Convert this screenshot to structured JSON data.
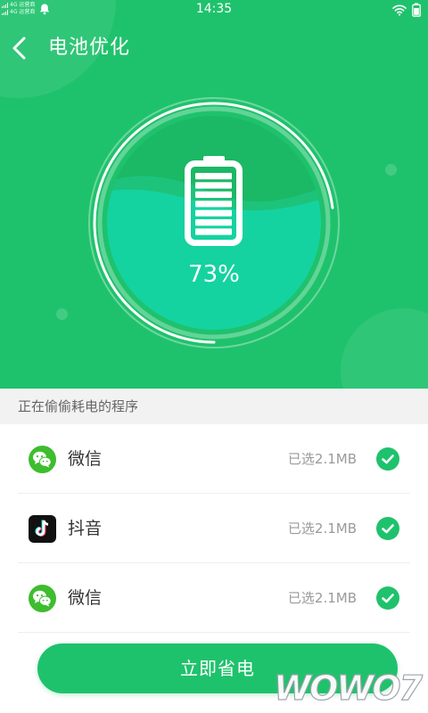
{
  "statusbar": {
    "network_line1": "4G 运营商",
    "network_line2": "4G 运营商",
    "time": "14:35"
  },
  "header": {
    "title": "电池优化"
  },
  "battery": {
    "percent_label": "73%",
    "level": 0.73
  },
  "section": {
    "title": "正在偷偷耗电的程序"
  },
  "apps": [
    {
      "name": "微信",
      "size": "已选2.1MB",
      "icon": "wechat-icon",
      "checked": true
    },
    {
      "name": "抖音",
      "size": "已选2.1MB",
      "icon": "tiktok-icon",
      "checked": true
    },
    {
      "name": "微信",
      "size": "已选2.1MB",
      "icon": "wechat-icon",
      "checked": true
    }
  ],
  "action": {
    "label": "立即省电"
  },
  "watermark": "WOWO7",
  "colors": {
    "accent": "#1fc26c",
    "water": "#13d5a0"
  }
}
